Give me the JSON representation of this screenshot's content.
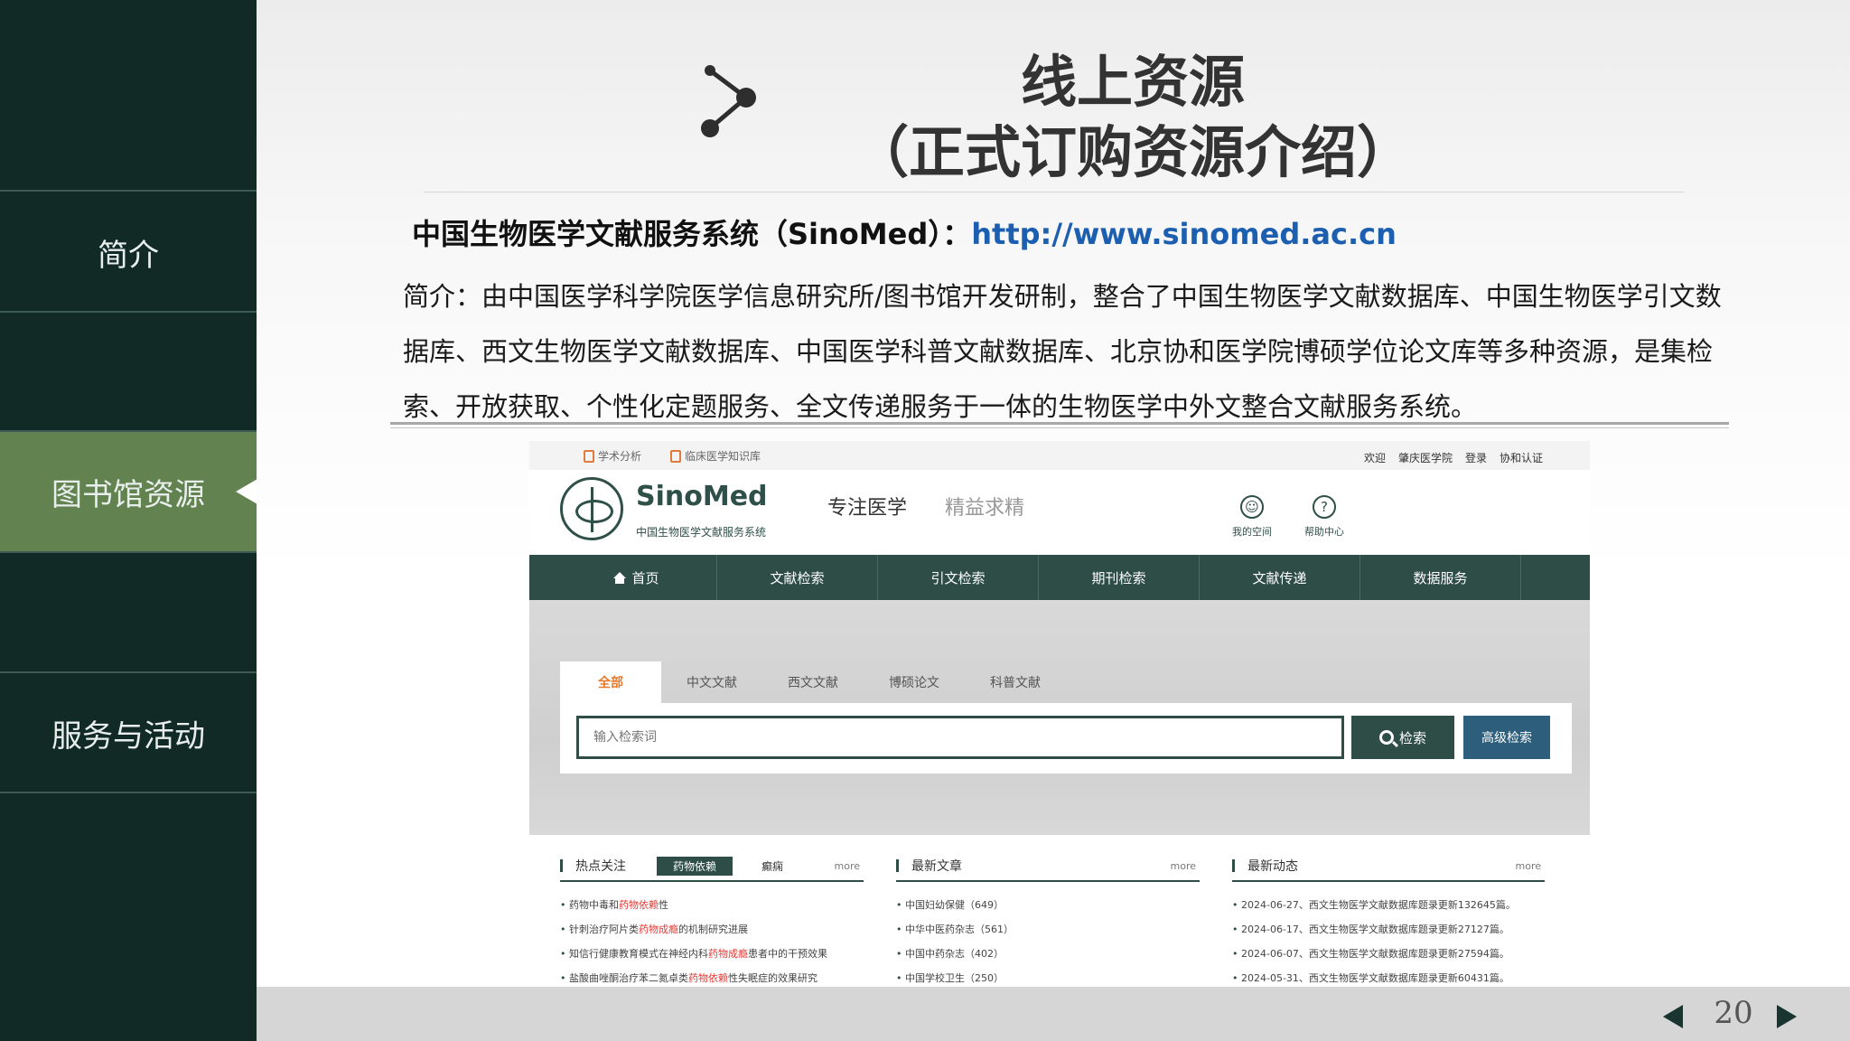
{
  "sidebar": {
    "items": [
      {
        "label": "简介",
        "active": false
      },
      {
        "label": "",
        "active": false
      },
      {
        "label": "图书馆资源",
        "active": true
      },
      {
        "label": "",
        "active": false
      },
      {
        "label": "服务与活动",
        "active": false
      }
    ],
    "active_color": "#62824f",
    "background_color": "#112a26"
  },
  "slide": {
    "title_line1": "线上资源",
    "title_line2": "（正式订购资源介绍）",
    "heading_label": "中国生物医学文献服务系统（SinoMed）：",
    "heading_link": "http://www.sinomed.ac.cn",
    "intro": "简介：由中国医学科学院医学信息研究所/图书馆开发研制，整合了中国生物医学文献数据库、中国生物医学引文数据库、西文生物医学文献数据库、中国医学科普文献数据库、北京协和医学院博硕学位论文库等多种资源，是集检索、开放获取、个性化定题服务、全文传递服务于一体的生物医学中外文整合文献服务系统。",
    "page_number": "20",
    "link_color": "#1c5fb0"
  },
  "sinomed": {
    "topbar": {
      "links": [
        "学术分析",
        "临床医学知识库"
      ],
      "right": [
        "欢迎",
        "肇庆医学院",
        "登录",
        "协和认证"
      ]
    },
    "brand": "SinoMed",
    "brand_sub": "中国生物医学文献服务系统",
    "slogan_1": "专注医学",
    "slogan_2": "精益求精",
    "tools": [
      "我的空间",
      "帮助中心"
    ],
    "nav": [
      "首页",
      "文献检索",
      "引文检索",
      "期刊检索",
      "文献传递",
      "数据服务"
    ],
    "tabs": [
      "全部",
      "中文文献",
      "西文文献",
      "博硕论文",
      "科普文献"
    ],
    "search_placeholder": "输入检索词",
    "search_button": "检索",
    "advanced_button": "高级检索",
    "columns": {
      "hot": {
        "title": "热点关注",
        "pill_active": "药物依赖",
        "pill_other": "癫痫",
        "more": "more",
        "items": [
          [
            "药物中毒和",
            "药物依赖",
            "性"
          ],
          [
            "针刺治疗阿片类",
            "药物成瘾",
            "的机制研究进展"
          ],
          [
            "知信行健康教育模式在神经内科",
            "药物成瘾",
            "患者中的干预效果"
          ],
          [
            "盐酸曲唑酮治疗苯二氮卓类",
            "药物依赖",
            "性失眠症的效果研究"
          ]
        ]
      },
      "articles": {
        "title": "最新文章",
        "more": "more",
        "items": [
          "中国妇幼保健（649）",
          "中华中医药杂志（561）",
          "中国中药杂志（402）",
          "中国学校卫生（250）"
        ]
      },
      "news": {
        "title": "最新动态",
        "more": "more",
        "items": [
          "2024-06-27、西文生物医学文献数据库题录更新132645篇。",
          "2024-06-17、西文生物医学文献数据库题录更新27127篇。",
          "2024-06-07、西文生物医学文献数据库题录更新27594篇。",
          "2024-05-31、西文生物医学文献数据库题录更新60431篇。"
        ]
      }
    },
    "colors": {
      "nav": "#2e4d47",
      "accent_tab": "#e8792a",
      "highlight": "#e53935",
      "advanced_button": "#2d5f7c"
    }
  }
}
